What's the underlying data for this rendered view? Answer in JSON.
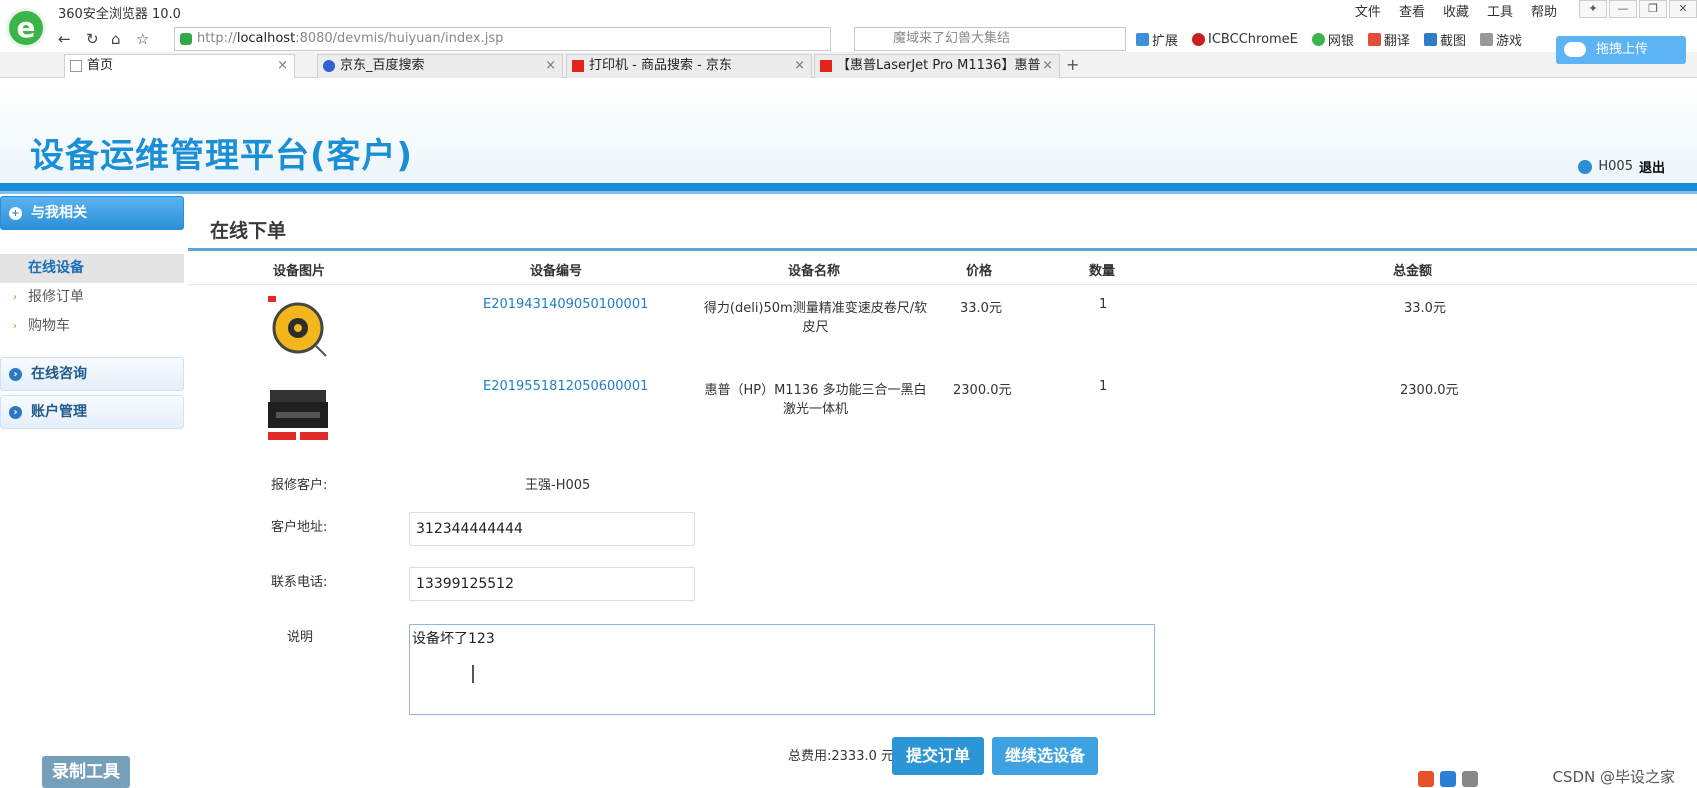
{
  "browser": {
    "app_title": "360安全浏览器 10.0",
    "menu": [
      "文件",
      "查看",
      "收藏",
      "工具",
      "帮助"
    ],
    "url_prefix": "http://",
    "url_host": "localhost",
    "url_rest": ":8080/devmis/huiyuan/index.jsp",
    "search_placeholder": "魔域来了幻兽大集结",
    "toolbar": [
      "扩展",
      "ICBCChromeE",
      "网银",
      "翻译",
      "截图",
      "游戏"
    ],
    "tabs": [
      {
        "label": "首页",
        "active": true
      },
      {
        "label": "京东_百度搜索",
        "active": false
      },
      {
        "label": "打印机 - 商品搜索 - 京东",
        "active": false
      },
      {
        "label": "【惠普LaserJet Pro M1136】惠普",
        "active": false
      }
    ],
    "new_tab": "+",
    "upload_label": "拖拽上传"
  },
  "header": {
    "title": "设备运维管理平台(客户)",
    "user": "H005",
    "logout": "退出"
  },
  "sidebar": {
    "groups": [
      {
        "label": "与我相关",
        "active": true,
        "items": [
          {
            "label": "在线设备",
            "active": true
          },
          {
            "label": "报修订单",
            "active": false
          },
          {
            "label": "购物车",
            "active": false
          }
        ]
      },
      {
        "label": "在线咨询",
        "active": false,
        "items": []
      },
      {
        "label": "账户管理",
        "active": false,
        "items": []
      }
    ]
  },
  "main": {
    "title": "在线下单",
    "columns": [
      "设备图片",
      "设备编号",
      "设备名称",
      "价格",
      "数量",
      "总金额"
    ],
    "rows": [
      {
        "code": "E20194314090501000​01",
        "name_line1": "得力(deli)50m测量精准变速皮卷尺/软",
        "name_line2": "皮尺",
        "price": "33.0元",
        "qty": "1",
        "total": "33.0元"
      },
      {
        "code": "E2019551812050600001",
        "name_line1": "惠普（HP）M1136 多功能三合一黑白",
        "name_line2": "激光一体机",
        "price": "2300.0元",
        "qty": "1",
        "total": "2300.0元"
      }
    ],
    "form": {
      "customer_label": "报修客户:",
      "customer_value": "王强-H005",
      "address_label": "客户地址:",
      "address_value": "312344444444",
      "phone_label": "联系电话:",
      "phone_value": "13399125512",
      "desc_label": "说明",
      "desc_value": "设备坏了123"
    },
    "total_text": "总费用:2333.0 元",
    "submit_label": "提交订单",
    "continue_label": "继续选设备"
  },
  "overlay": {
    "tool_watermark": "录制工具",
    "csdn": "CSDN @毕设之家"
  }
}
